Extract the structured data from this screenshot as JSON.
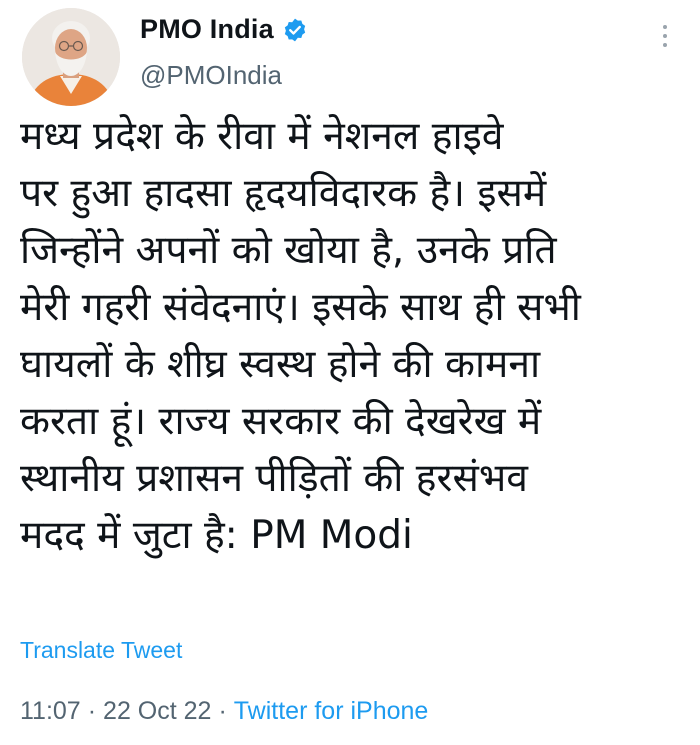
{
  "account": {
    "display_name": "PMO India",
    "handle": "@PMOIndia",
    "verified": true,
    "avatar": "profile-photo"
  },
  "tweet": {
    "lines": [
      "मध्य प्रदेश के रीवा में नेशनल हाइवे",
      "पर हुआ हादसा हृदयविदारक है। इसमें",
      "जिन्होंने अपनों को खोया है, उनके प्रति",
      "मेरी गहरी संवेदनाएं। इसके साथ ही सभी",
      "घायलों के शीघ्र स्वस्थ होने की कामना",
      "करता हूं। राज्य सरकार की देखरेख में",
      "स्थानीय प्रशासन पीड़ितों की हरसंभव",
      "मदद में जुटा है: PM Modi"
    ],
    "translate_label": "Translate Tweet",
    "time": "11:07",
    "date": "22 Oct 22",
    "source": "Twitter for iPhone",
    "separator": "·"
  },
  "icons": {
    "verified": "verified-badge-icon",
    "more": "more-options-icon"
  },
  "colors": {
    "text": "#0f1419",
    "secondary": "#536471",
    "link": "#1d9bf0",
    "verified": "#1d9bf0",
    "background": "#ffffff"
  }
}
